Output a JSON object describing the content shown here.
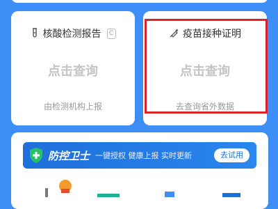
{
  "cards": {
    "nucleic": {
      "title": "核酸检测报告",
      "badge": "C",
      "action": "点击查询",
      "footer": "由检测机构上报"
    },
    "vaccine": {
      "title": "疫苗接种证明",
      "action": "点击查询",
      "footer": "去查询省外数据"
    }
  },
  "banner": {
    "brand": "防控卫士",
    "slogan": "一键授权  健康上报  实时更新",
    "cta": "去试用"
  },
  "colors": {
    "background": "#3d8ef7",
    "highlight_border": "#d9232c",
    "banner": "#1e6fd9"
  }
}
